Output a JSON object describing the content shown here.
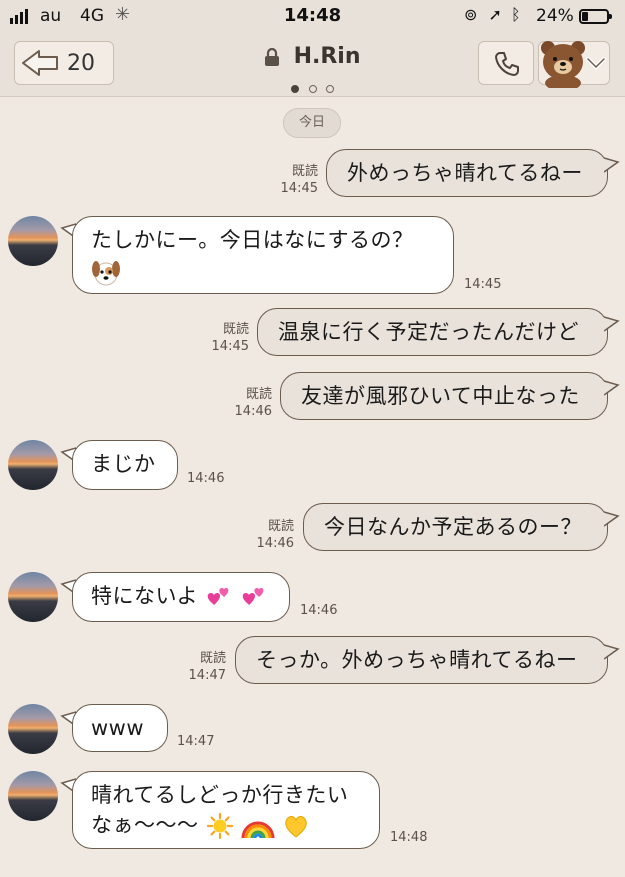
{
  "status_bar": {
    "carrier": "au",
    "network": "4G",
    "time": "14:48",
    "battery": "24%"
  },
  "header": {
    "back_count": "20",
    "title": "H.Rin",
    "page_indicator": {
      "total": 3,
      "active": 1
    }
  },
  "date_divider": "今日",
  "read_label": "既読",
  "messages": [
    {
      "side": "mine",
      "text": "外めっちゃ晴れてるねー",
      "time": "14:45"
    },
    {
      "side": "theirs",
      "text": "たしかにー。今日はなにするの？",
      "emoji": [
        "dog-face-emoji"
      ],
      "time": "14:45"
    },
    {
      "side": "mine",
      "text": "温泉に行く予定だったんだけど",
      "time": "14:45"
    },
    {
      "side": "mine",
      "text": "友達が風邪ひいて中止なった",
      "time": "14:46"
    },
    {
      "side": "theirs",
      "text": "まじか",
      "time": "14:46"
    },
    {
      "side": "mine",
      "text": "今日なんか予定あるのー？",
      "time": "14:46"
    },
    {
      "side": "theirs",
      "text": "特にないよ",
      "emoji": [
        "two-hearts-emoji",
        "two-hearts-emoji"
      ],
      "time": "14:46"
    },
    {
      "side": "mine",
      "text": "そっか。外めっちゃ晴れてるねー",
      "time": "14:47"
    },
    {
      "side": "theirs",
      "text": "www",
      "time": "14:47"
    },
    {
      "side": "theirs",
      "text_lines": [
        "晴れてるしどっか行きたい",
        "なぁ〜〜〜"
      ],
      "emoji": [
        "sun-emoji",
        "rainbow-emoji",
        "yellow-heart-emoji"
      ],
      "time": "14:48"
    }
  ],
  "colors": {
    "background": "#efe9e2",
    "header": "#e8e1d9",
    "my_bubble": "#e9e2da",
    "their_bubble": "#ffffff",
    "bubble_border": "#6b5c4e"
  }
}
